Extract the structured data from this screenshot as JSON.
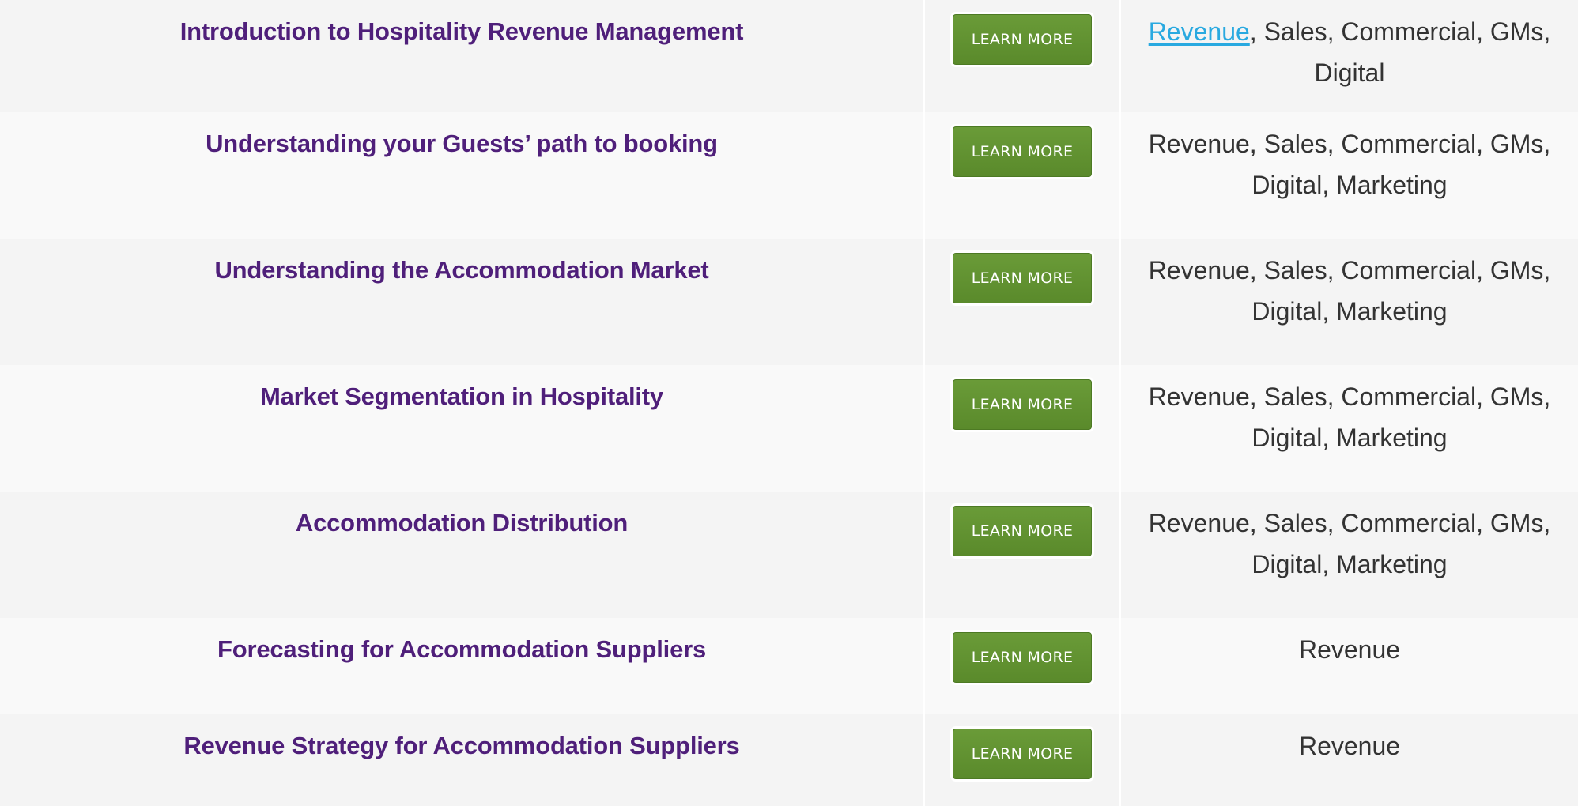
{
  "rows": [
    {
      "title": "Introduction to Hospitality Revenue Management",
      "button": "LEARN MORE",
      "tags_link": "Revenue",
      "tags_rest": ", Sales, Commercial, GMs, Digital"
    },
    {
      "title": "Understanding your Guests’ path to booking",
      "button": "LEARN MORE",
      "tags": "Revenue, Sales, Commercial, GMs, Digital, Marketing"
    },
    {
      "title": "Understanding the Accommodation Market",
      "button": "LEARN MORE",
      "tags": "Revenue, Sales, Commercial, GMs, Digital, Marketing"
    },
    {
      "title": "Market Segmentation in Hospitality",
      "button": "LEARN MORE",
      "tags": "Revenue, Sales, Commercial, GMs, Digital, Marketing"
    },
    {
      "title": "Accommodation Distribution",
      "button": "LEARN MORE",
      "tags": "Revenue, Sales, Commercial, GMs, Digital, Marketing"
    },
    {
      "title": "Forecasting for Accommodation Suppliers",
      "button": "LEARN MORE",
      "tags": "Revenue"
    },
    {
      "title": "Revenue Strategy for Accommodation Suppliers",
      "button": "LEARN MORE",
      "tags": "Revenue"
    }
  ],
  "colors": {
    "title": "#4f1f7a",
    "button": "#5f922f",
    "link": "#29a9e0",
    "row_odd": "#f4f4f4",
    "row_even": "#f9f9f9"
  }
}
